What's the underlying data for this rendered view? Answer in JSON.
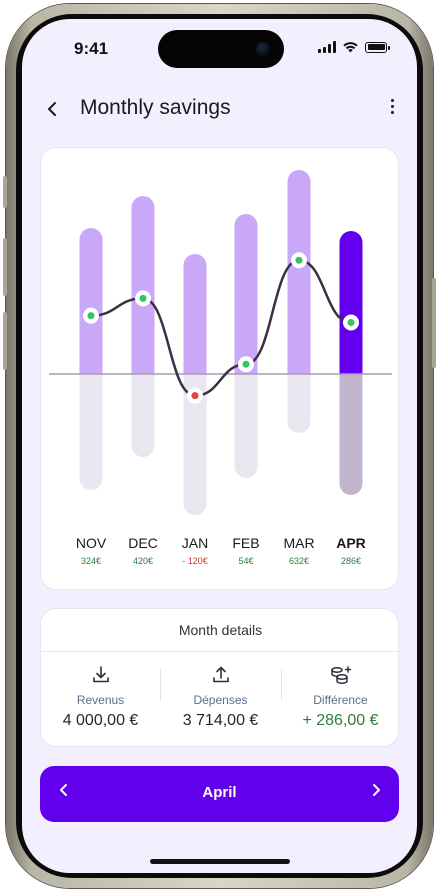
{
  "status_bar": {
    "time": "9:41"
  },
  "header": {
    "title": "Monthly savings",
    "back_icon": "chevron-left-icon",
    "menu_icon": "more-vertical-icon"
  },
  "chart_data": {
    "type": "bar",
    "categories": [
      "NOV",
      "DEC",
      "JAN",
      "FEB",
      "MAR",
      "APR"
    ],
    "value_labels": [
      "324€",
      "420€",
      "- 120€",
      "54€",
      "632€",
      "286€"
    ],
    "series": [
      {
        "values": [
          324,
          420,
          -120,
          54,
          632,
          286
        ]
      }
    ],
    "selected": "APR",
    "colors": {
      "income_bar": "#c9a8f7",
      "expense_bar": "#e9e6ef",
      "selected_income": "#6200ee",
      "selected_expense": "#c2b6ce",
      "line": "#3a3045",
      "positive_point": "#34c466",
      "negative_point": "#e0443a",
      "baseline": "#a79cb0",
      "positive_text": "#2e7d3a",
      "negative_text": "#d23a2f"
    }
  },
  "details": {
    "title": "Month details",
    "columns": [
      {
        "label": "Revenus",
        "amount": "4 000,00 €",
        "icon": "download-icon"
      },
      {
        "label": "Dépenses",
        "amount": "3 714,00 €",
        "icon": "upload-icon"
      },
      {
        "label": "Différence",
        "amount": "+ 286,00 €",
        "icon": "coins-plus-icon"
      }
    ]
  },
  "month_selector": {
    "label": "April",
    "prev_icon": "chevron-left-icon",
    "next_icon": "chevron-right-icon"
  }
}
